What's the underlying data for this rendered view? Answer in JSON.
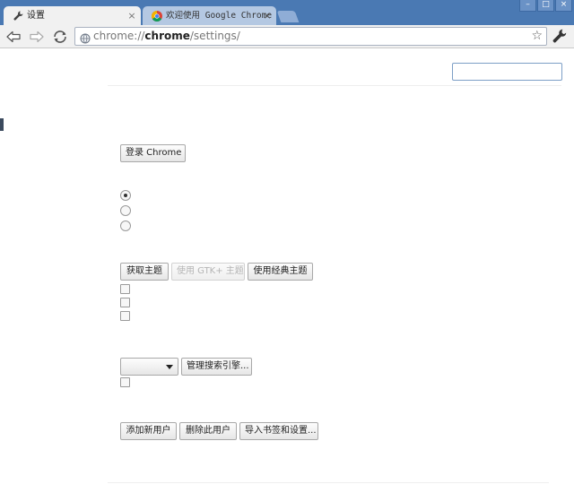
{
  "tabs": [
    {
      "title": "设置",
      "close": "×",
      "active": true
    },
    {
      "title": "欢迎使用 Google Chrome §",
      "close": "×",
      "active": false
    }
  ],
  "window_buttons": {
    "minimize": "–",
    "maximize": "□",
    "close": "×"
  },
  "toolbar": {
    "url_scheme": "chrome://",
    "url_host": "chrome",
    "url_path": "/settings/",
    "star": "☆"
  },
  "settings": {
    "sign_in_button": "登录 Chrome",
    "get_themes_button": "获取主题",
    "use_gtk_theme_button": "使用 GTK+ 主题",
    "use_classic_theme_button": "使用经典主题",
    "search_engine_selected": "",
    "manage_search_engines_button": "管理搜索引擎...",
    "add_user_button": "添加新用户",
    "delete_user_button": "删除此用户",
    "import_bookmarks_button": "导入书签和设置..."
  },
  "colors": {
    "titlebar": "#4a79b3",
    "toolbar": "#f1f1f1",
    "search_border": "#7d9fc6"
  }
}
